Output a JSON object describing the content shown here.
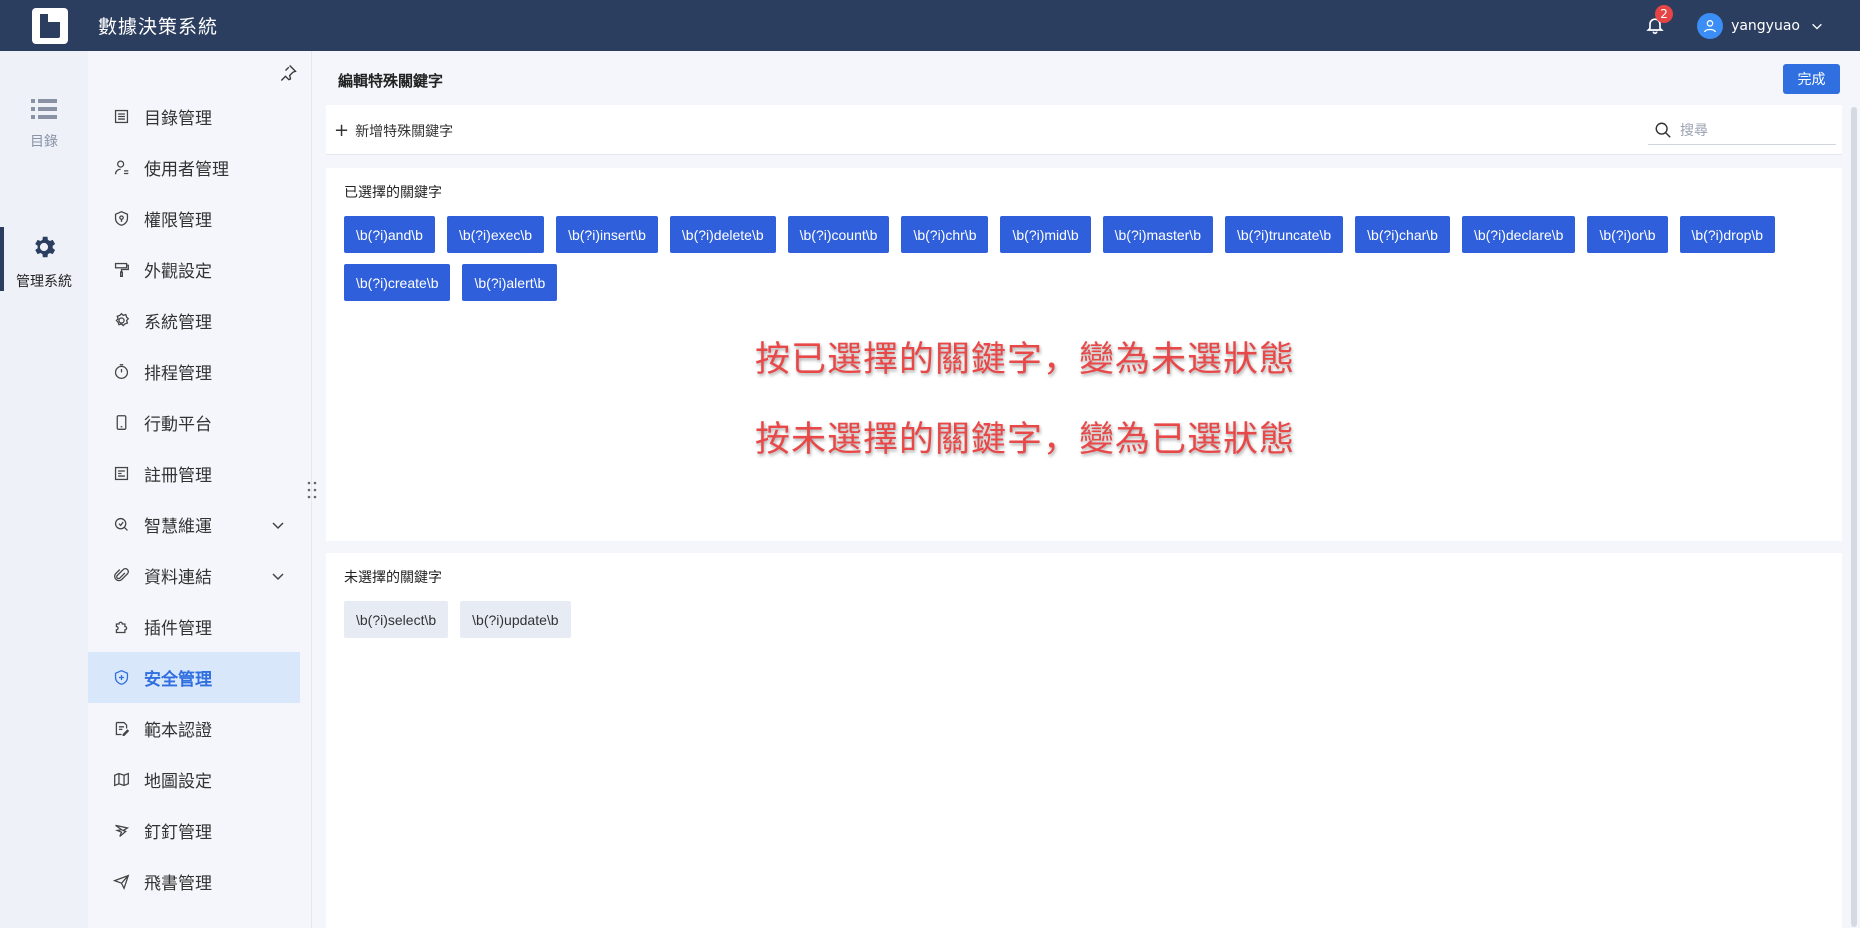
{
  "header": {
    "app_title": "數據決策系統",
    "notification_count": "2",
    "username": "yangyuao"
  },
  "rail": {
    "items": [
      {
        "label": "目錄",
        "icon": "list-icon",
        "active": false
      },
      {
        "label": "管理系統",
        "icon": "gear-icon",
        "active": true
      }
    ]
  },
  "nav": {
    "items": [
      {
        "label": "目錄管理",
        "icon": "catalog-icon"
      },
      {
        "label": "使用者管理",
        "icon": "user-icon"
      },
      {
        "label": "權限管理",
        "icon": "permission-icon"
      },
      {
        "label": "外觀設定",
        "icon": "paint-roller-icon"
      },
      {
        "label": "系統管理",
        "icon": "settings-icon"
      },
      {
        "label": "排程管理",
        "icon": "timer-icon"
      },
      {
        "label": "行動平台",
        "icon": "mobile-icon"
      },
      {
        "label": "註冊管理",
        "icon": "register-icon"
      },
      {
        "label": "智慧維運",
        "icon": "smart-ops-icon",
        "expandable": true
      },
      {
        "label": "資料連結",
        "icon": "paperclip-icon",
        "expandable": true
      },
      {
        "label": "插件管理",
        "icon": "puzzle-icon"
      },
      {
        "label": "安全管理",
        "icon": "shield-icon",
        "active": true
      },
      {
        "label": "範本認證",
        "icon": "template-cert-icon"
      },
      {
        "label": "地圖設定",
        "icon": "map-icon"
      },
      {
        "label": "釘釘管理",
        "icon": "dingtalk-icon"
      },
      {
        "label": "飛書管理",
        "icon": "feishu-icon"
      }
    ]
  },
  "page": {
    "title": "編輯特殊關鍵字",
    "done_label": "完成",
    "add_label": "新增特殊關鍵字",
    "search_placeholder": "搜尋"
  },
  "selected": {
    "title": "已選擇的關鍵字",
    "keywords": [
      "\\b(?i)and\\b",
      "\\b(?i)exec\\b",
      "\\b(?i)insert\\b",
      "\\b(?i)delete\\b",
      "\\b(?i)count\\b",
      "\\b(?i)chr\\b",
      "\\b(?i)mid\\b",
      "\\b(?i)master\\b",
      "\\b(?i)truncate\\b",
      "\\b(?i)char\\b",
      "\\b(?i)declare\\b",
      "\\b(?i)or\\b",
      "\\b(?i)drop\\b",
      "\\b(?i)create\\b",
      "\\b(?i)alert\\b"
    ]
  },
  "unselected": {
    "title": "未選擇的關鍵字",
    "keywords": [
      "\\b(?i)select\\b",
      "\\b(?i)update\\b"
    ]
  },
  "annotations": {
    "line1": "按已選擇的關鍵字，變為未選狀態",
    "line2": "按未選擇的關鍵字，變為已選狀態"
  }
}
